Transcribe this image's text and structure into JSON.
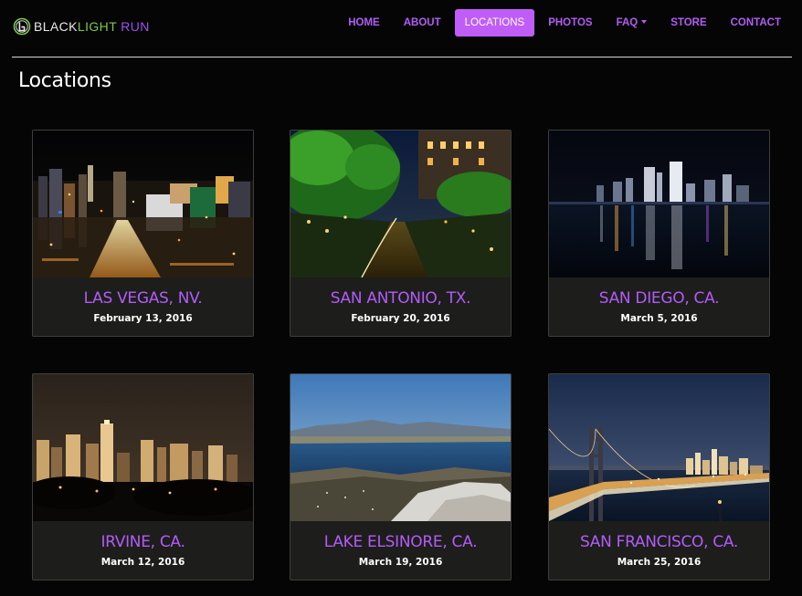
{
  "brand": {
    "black": "BLACK",
    "light": "LIGHT",
    "run": " RUN"
  },
  "nav": {
    "items": [
      {
        "label": "HOME"
      },
      {
        "label": "ABOUT"
      },
      {
        "label": "LOCATIONS",
        "active": true
      },
      {
        "label": "PHOTOS"
      },
      {
        "label": "FAQ",
        "dropdown": true
      },
      {
        "label": "STORE"
      },
      {
        "label": "CONTACT"
      }
    ]
  },
  "page": {
    "title": "Locations"
  },
  "locations": [
    {
      "name": "LAS VEGAS, NV.",
      "date": "February 13, 2016",
      "image": "city-night-strip-icon"
    },
    {
      "name": "SAN ANTONIO, TX.",
      "date": "February 20, 2016",
      "image": "riverwalk-night-icon"
    },
    {
      "name": "SAN DIEGO, CA.",
      "date": "March 5, 2016",
      "image": "skyline-reflection-icon"
    },
    {
      "name": "IRVINE, CA.",
      "date": "March 12, 2016",
      "image": "city-night-skyline-icon"
    },
    {
      "name": "LAKE ELSINORE, CA.",
      "date": "March 19, 2016",
      "image": "lake-landscape-icon"
    },
    {
      "name": "SAN FRANCISCO, CA.",
      "date": "March 25, 2016",
      "image": "bridge-dusk-icon"
    }
  ],
  "colors": {
    "accent": "#b25cf8",
    "active_bg": "#c05cf8",
    "background": "#060505",
    "card_bg": "#1d1d1c"
  }
}
